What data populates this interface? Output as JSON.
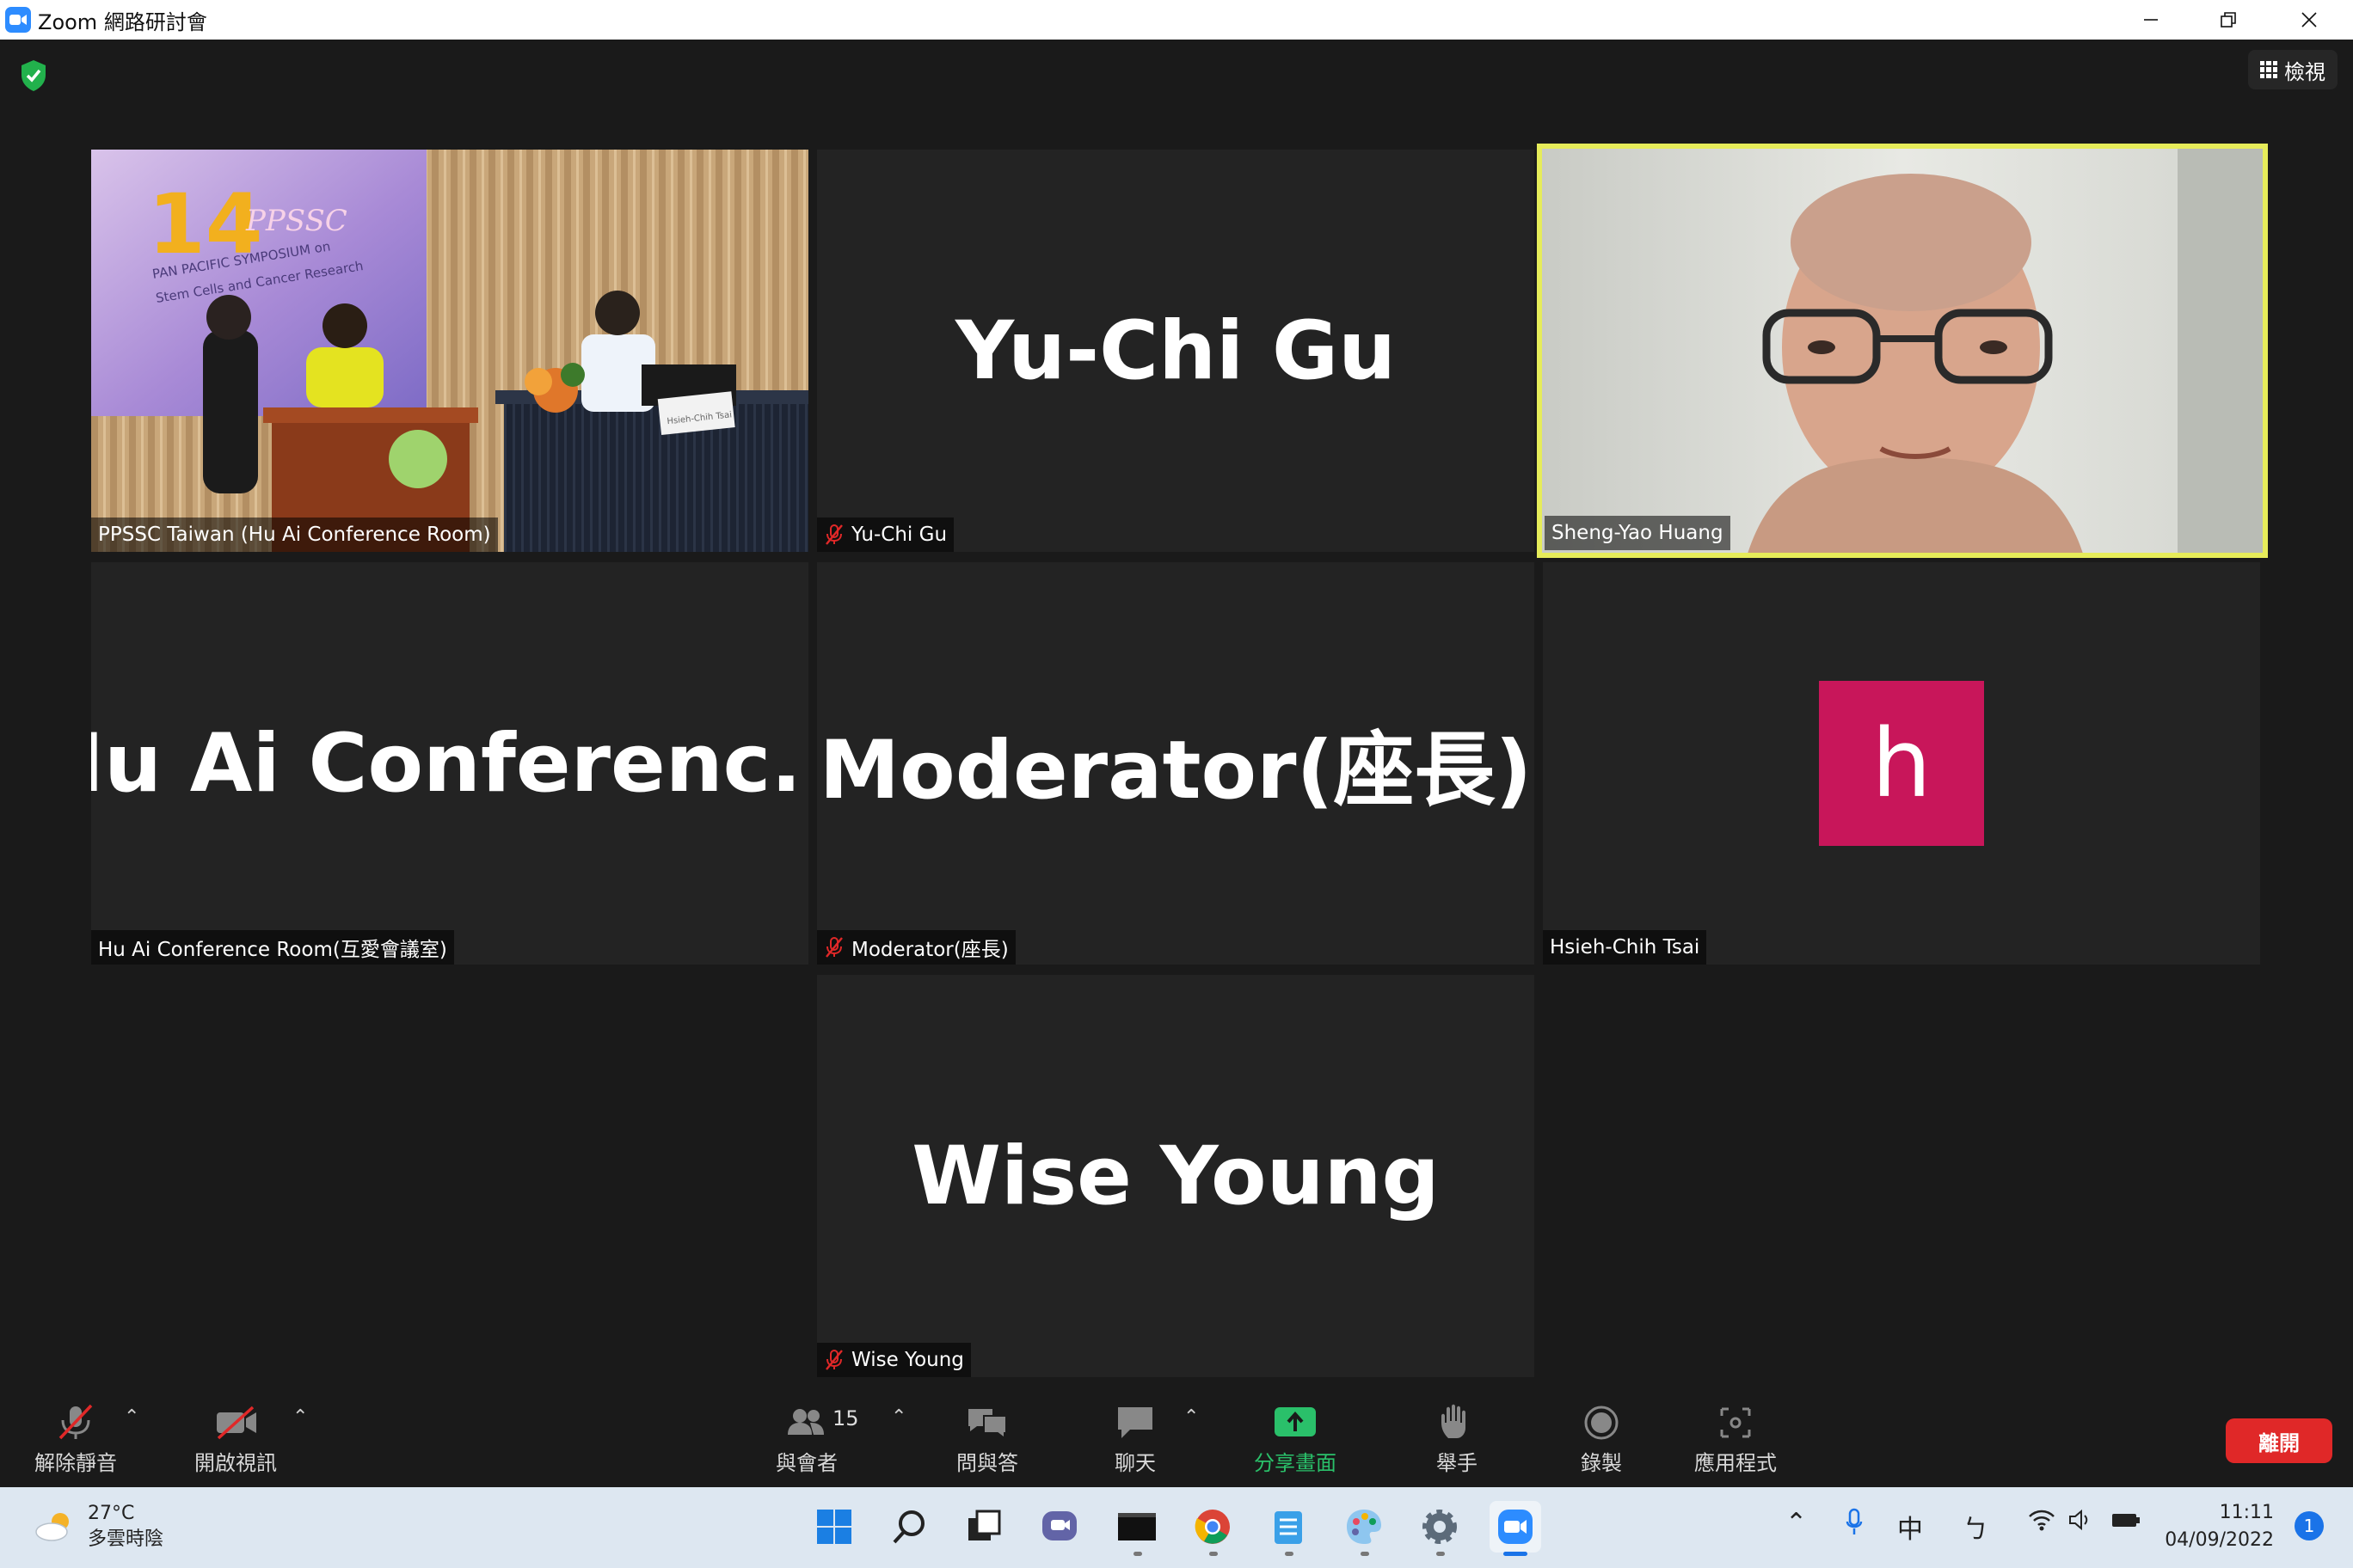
{
  "window": {
    "title": "Zoom 網路研討會"
  },
  "header": {
    "view_label": "檢視"
  },
  "tiles": [
    {
      "label": "PPSSC Taiwan (Hu Ai Conference Room)",
      "type": "video-room"
    },
    {
      "big_name": "Yu-Chi Gu",
      "label": "Yu-Chi Gu",
      "muted": true
    },
    {
      "label": "Sheng-Yao Huang",
      "type": "video-person",
      "active_speaker": true
    },
    {
      "big_name": "Hu Ai Conferenc...",
      "label": "Hu Ai Conference Room(互愛會議室)",
      "muted": false
    },
    {
      "big_name": "Moderator(座長)",
      "label": "Moderator(座長)",
      "muted": true
    },
    {
      "avatar_letter": "h",
      "label": "Hsieh-Chih Tsai",
      "avatar_color": "#c8165a"
    },
    {
      "big_name": "Wise Young",
      "label": "Wise Young",
      "muted": true
    }
  ],
  "room_scene": {
    "banner_number": "14",
    "banner_brand": "PPSSC",
    "banner_line1": "PAN PACIFIC SYMPOSIUM on",
    "banner_line2": "Stem Cells and Cancer Research",
    "nameplate": "Hsieh-Chih Tsai"
  },
  "toolbar": {
    "unmute": "解除靜音",
    "start_video": "開啟視訊",
    "participants": "與會者",
    "participants_count": "15",
    "qa": "問與答",
    "chat": "聊天",
    "share_screen": "分享畫面",
    "raise_hand": "舉手",
    "record": "錄製",
    "apps": "應用程式",
    "leave": "離開"
  },
  "taskbar": {
    "temperature": "27°C",
    "weather": "多雲時陰",
    "ime_lang": "中",
    "ime_mode": "ㄅ",
    "time": "11:11",
    "date": "04/09/2022",
    "notifications": "1"
  },
  "colors": {
    "accent": "#2d8cff",
    "active_speaker": "#e6ec5a",
    "leave": "#e02828",
    "share": "#2ac06a"
  }
}
